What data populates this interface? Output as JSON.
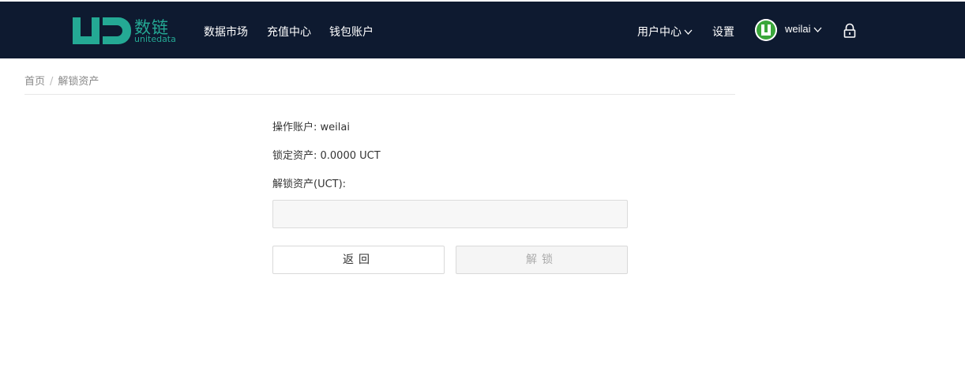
{
  "header": {
    "logo_cn": "数链",
    "logo_en": "unitedata",
    "nav": [
      {
        "label": "数据市场"
      },
      {
        "label": "充值中心"
      },
      {
        "label": "钱包账户"
      }
    ],
    "user_center_label": "用户中心",
    "settings_label": "设置",
    "username": "weilai",
    "brand_color": "#24a994",
    "bg_color": "#0e1a30"
  },
  "breadcrumb": {
    "home": "首页",
    "separator": "/",
    "current": "解锁资产"
  },
  "form": {
    "account_label": "操作账户: weilai",
    "locked_label": "锁定资产: 0.0000 UCT",
    "unlock_label": "解锁资产(UCT):",
    "unlock_value": "",
    "unlock_placeholder": ""
  },
  "buttons": {
    "back_label": "返回",
    "unlock_label": "解锁"
  }
}
